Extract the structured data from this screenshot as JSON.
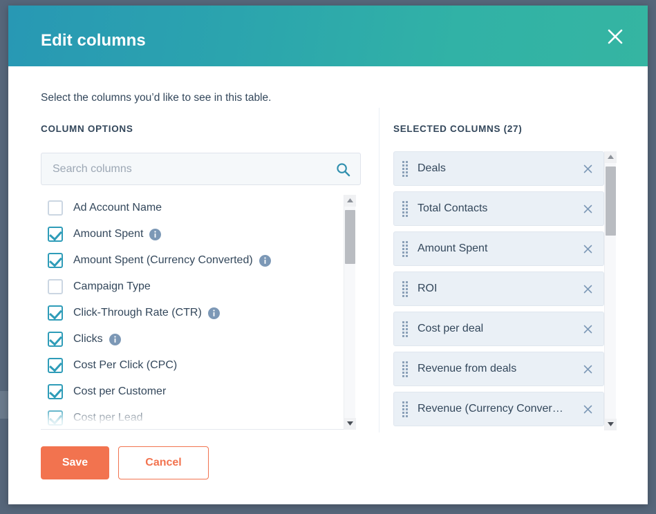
{
  "modal": {
    "title": "Edit columns",
    "close_icon": "close-icon",
    "intro": "Select the columns you’d like to see in this table.",
    "header_gradient_from": "#2898b4",
    "header_gradient_to": "#35b5a2"
  },
  "left_panel": {
    "heading": "COLUMN OPTIONS",
    "search": {
      "placeholder": "Search columns",
      "value": "",
      "icon": "search-icon"
    },
    "options": [
      {
        "label": "Ad Account Name",
        "checked": false,
        "info": false
      },
      {
        "label": "Amount Spent",
        "checked": true,
        "info": true
      },
      {
        "label": "Amount Spent (Currency Converted)",
        "checked": true,
        "info": true
      },
      {
        "label": "Campaign Type",
        "checked": false,
        "info": false
      },
      {
        "label": "Click-Through Rate (CTR)",
        "checked": true,
        "info": true
      },
      {
        "label": "Clicks",
        "checked": true,
        "info": true
      },
      {
        "label": "Cost Per Click (CPC)",
        "checked": true,
        "info": false
      },
      {
        "label": "Cost per Customer",
        "checked": true,
        "info": false
      },
      {
        "label": "Cost per Lead",
        "checked": true,
        "info": false
      }
    ]
  },
  "right_panel": {
    "heading": "SELECTED COLUMNS (27)",
    "count": 27,
    "chips": [
      {
        "label": "Deals"
      },
      {
        "label": "Total Contacts"
      },
      {
        "label": "Amount Spent"
      },
      {
        "label": "ROI"
      },
      {
        "label": "Cost per deal"
      },
      {
        "label": "Revenue from deals"
      },
      {
        "label": "Revenue (Currency Conver…"
      }
    ],
    "remove_icon": "close-icon",
    "drag_icon": "drag-handle-icon"
  },
  "footer": {
    "save_label": "Save",
    "cancel_label": "Cancel",
    "save_color": "#f2734f"
  }
}
